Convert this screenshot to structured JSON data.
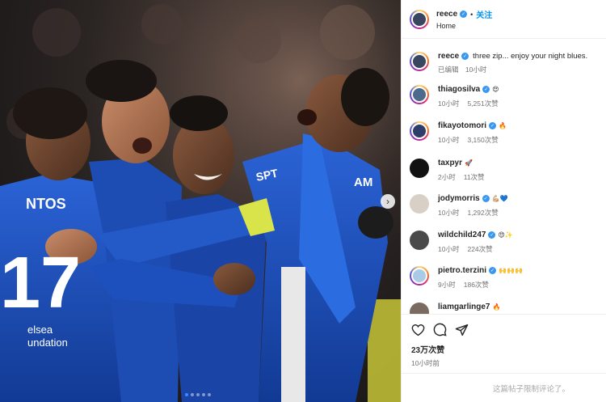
{
  "header": {
    "username": "reece",
    "separator": "•",
    "follow_label": "关注",
    "subtitle": "Home"
  },
  "caption": {
    "username": "reece",
    "text": "three zip... enjoy your night blues.",
    "edited": "已编辑",
    "time": "10小时"
  },
  "comments": [
    {
      "username": "thiagosilva",
      "verified": true,
      "emoji": "😍",
      "time": "10小时",
      "likes": "5,251次赞"
    },
    {
      "username": "fikayotomori",
      "verified": true,
      "emoji": "🔥",
      "time": "10小时",
      "likes": "3,150次赞"
    },
    {
      "username": "taxpyr",
      "verified": false,
      "emoji": "🚀",
      "time": "2小时",
      "likes": "11次赞"
    },
    {
      "username": "jodymorris",
      "verified": true,
      "emoji": "💪🏼💙",
      "time": "10小时",
      "likes": "1,292次赞"
    },
    {
      "username": "wildchild247",
      "verified": true,
      "emoji": "😍✨",
      "time": "10小时",
      "likes": "224次赞"
    },
    {
      "username": "pietro.terzini",
      "verified": true,
      "emoji": "🙌🙌🙌",
      "time": "9小时",
      "likes": "186次赞"
    },
    {
      "username": "liamgarlinge7",
      "verified": false,
      "emoji": "🔥",
      "time": "",
      "likes": ""
    }
  ],
  "footer": {
    "like_count": "23万次赞",
    "post_time": "10小时前",
    "comments_restricted": "这篇帖子限制评论了。"
  },
  "photo": {
    "icons": [
      "chevron-right-icon"
    ],
    "carousel_dots": 5,
    "active_dot": 0,
    "jersey_texts": [
      "NTOS",
      "17",
      "elsea",
      "undation",
      "SPT",
      "AM"
    ]
  },
  "colors": {
    "accent": "#0095f6",
    "kit_blue": "#1a4fb8",
    "verified": "#3897f0"
  }
}
